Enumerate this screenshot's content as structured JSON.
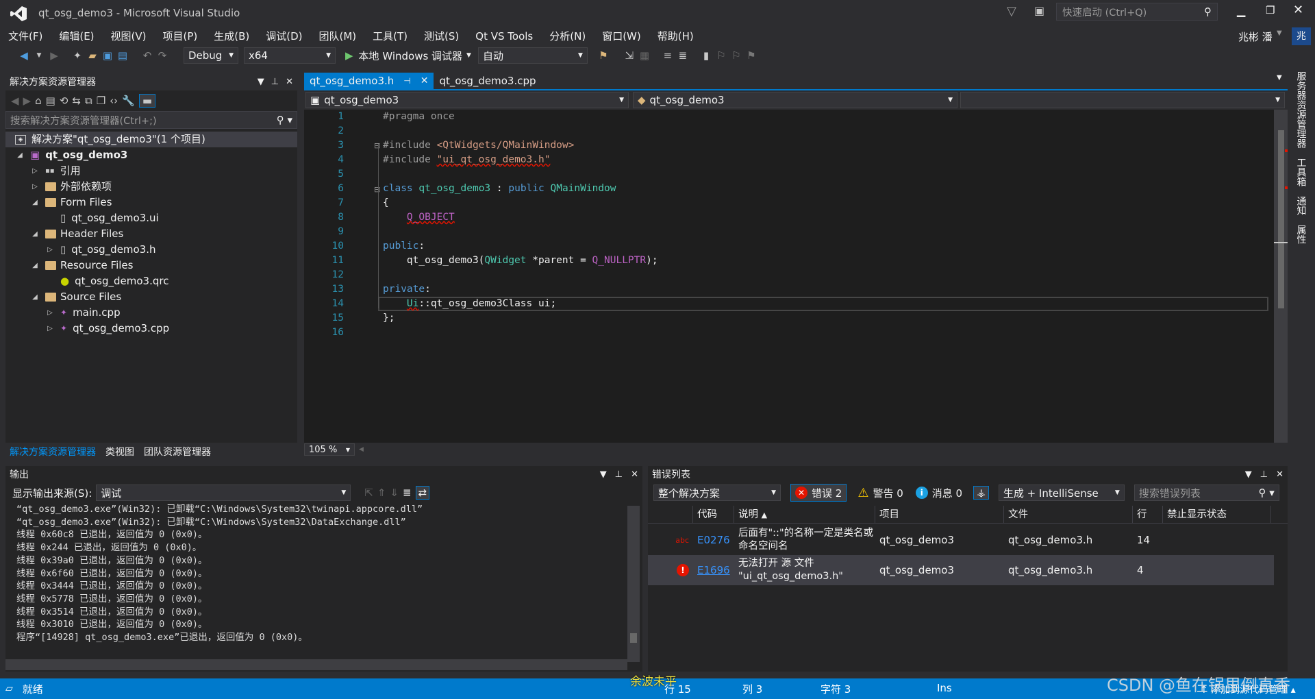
{
  "window": {
    "title": "qt_osg_demo3 - Microsoft Visual Studio",
    "quick_launch": "快速启动 (Ctrl+Q)",
    "user": "兆彬 潘",
    "avatar": "兆"
  },
  "menu": [
    "文件(F)",
    "编辑(E)",
    "视图(V)",
    "项目(P)",
    "生成(B)",
    "调试(D)",
    "团队(M)",
    "工具(T)",
    "测试(S)",
    "Qt VS Tools",
    "分析(N)",
    "窗口(W)",
    "帮助(H)"
  ],
  "toolbar": {
    "config": "Debug",
    "platform": "x64",
    "debugger": "本地 Windows 调试器",
    "auto": "自动"
  },
  "solution": {
    "title": "解决方案资源管理器",
    "search": "搜索解决方案资源管理器(Ctrl+;)",
    "root": "解决方案\"qt_osg_demo3\"(1 个项目)",
    "project": "qt_osg_demo3",
    "items": [
      {
        "label": "引用",
        "indent": 1,
        "arrow": "▷",
        "kind": "ref"
      },
      {
        "label": "外部依赖项",
        "indent": 1,
        "arrow": "▷",
        "kind": "ext"
      },
      {
        "label": "Form Files",
        "indent": 1,
        "arrow": "◢",
        "kind": "folder"
      },
      {
        "label": "qt_osg_demo3.ui",
        "indent": 2,
        "arrow": "",
        "kind": "file"
      },
      {
        "label": "Header Files",
        "indent": 1,
        "arrow": "◢",
        "kind": "folder"
      },
      {
        "label": "qt_osg_demo3.h",
        "indent": 2,
        "arrow": "▷",
        "kind": "file"
      },
      {
        "label": "Resource Files",
        "indent": 1,
        "arrow": "◢",
        "kind": "folder"
      },
      {
        "label": "qt_osg_demo3.qrc",
        "indent": 2,
        "arrow": "",
        "kind": "qrc"
      },
      {
        "label": "Source Files",
        "indent": 1,
        "arrow": "◢",
        "kind": "folder"
      },
      {
        "label": "main.cpp",
        "indent": 2,
        "arrow": "▷",
        "kind": "cpp"
      },
      {
        "label": "qt_osg_demo3.cpp",
        "indent": 2,
        "arrow": "▷",
        "kind": "cpp"
      }
    ],
    "tabs": [
      "解决方案资源管理器",
      "类视图",
      "团队资源管理器"
    ]
  },
  "editor": {
    "tabs": [
      "qt_osg_demo3.h",
      "qt_osg_demo3.cpp"
    ],
    "nav_left": "qt_osg_demo3",
    "nav_right": "qt_osg_demo3",
    "zoom": "105 %",
    "line_numbers": [
      "1",
      "2",
      "3",
      "4",
      "5",
      "6",
      "7",
      "8",
      "9",
      "10",
      "11",
      "12",
      "13",
      "14",
      "15",
      "16"
    ]
  },
  "side_tabs": [
    "服务器资源管理器",
    "工具箱",
    "通知",
    "属性"
  ],
  "output": {
    "title": "输出",
    "source_label": "显示输出来源(S):",
    "source": "调试",
    "lines": [
      "“qt_osg_demo3.exe”(Win32): 已卸载“C:\\Windows\\System32\\twinapi.appcore.dll”",
      "“qt_osg_demo3.exe”(Win32): 已卸载“C:\\Windows\\System32\\DataExchange.dll”",
      "线程 0x60c8 已退出，返回值为 0 (0x0)。",
      "线程 0x244 已退出，返回值为 0 (0x0)。",
      "线程 0x39a0 已退出，返回值为 0 (0x0)。",
      "线程 0x6f60 已退出，返回值为 0 (0x0)。",
      "线程 0x3444 已退出，返回值为 0 (0x0)。",
      "线程 0x5778 已退出，返回值为 0 (0x0)。",
      "线程 0x3514 已退出，返回值为 0 (0x0)。",
      "线程 0x3010 已退出，返回值为 0 (0x0)。",
      "程序“[14928] qt_osg_demo3.exe”已退出，返回值为 0 (0x0)。"
    ]
  },
  "errors": {
    "title": "错误列表",
    "scope": "整个解决方案",
    "err": "错误 2",
    "warn": "警告 0",
    "msg": "消息 0",
    "build": "生成 + IntelliSense",
    "search": "搜索错误列表",
    "cols": [
      "代码",
      "说明",
      "项目",
      "文件",
      "行",
      "禁止显示状态"
    ],
    "rows": [
      {
        "code": "E0276",
        "desc1": "后面有\"::\"的名称一定是类名或",
        "desc2": "命名空间名",
        "project": "qt_osg_demo3",
        "file": "qt_osg_demo3.h",
        "line": "14"
      },
      {
        "code": "E1696",
        "desc1": "无法打开 源 文件",
        "desc2": "\"ui_qt_osg_demo3.h\"",
        "project": "qt_osg_demo3",
        "file": "qt_osg_demo3.h",
        "line": "4"
      }
    ]
  },
  "status": {
    "ready": "就绪",
    "row": "行 15",
    "col": "列 3",
    "char": "字符 3",
    "ins": "Ins",
    "source_control": "添加到源代码管理",
    "overlay": "余波未平",
    "watermark": "CSDN @鱼在锅里倒直香"
  }
}
